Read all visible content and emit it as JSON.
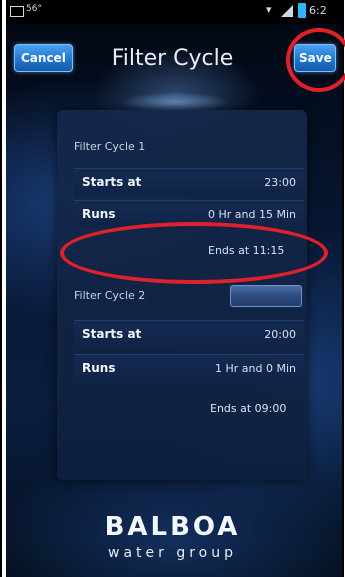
{
  "status_bar": {
    "temperature": "56°",
    "time": "6:2"
  },
  "header": {
    "cancel_label": "Cancel",
    "title": "Filter Cycle",
    "save_label": "Save"
  },
  "filter_cycles": [
    {
      "title": "Filter Cycle 1",
      "starts_label": "Starts at",
      "starts_value": "23:00",
      "runs_label": "Runs",
      "runs_value": "0 Hr and 15 Min",
      "ends": "Ends at 11:15"
    },
    {
      "title": "Filter Cycle 2",
      "starts_label": "Starts at",
      "starts_value": "20:00",
      "runs_label": "Runs",
      "runs_value": "1 Hr and 0 Min",
      "ends": "Ends at 09:00"
    }
  ],
  "logo": {
    "name": "BALBOA",
    "tagline": "water group"
  },
  "colors": {
    "accent": "#2276cf",
    "annotation": "#e0202a",
    "background": "#0a1d3e"
  }
}
